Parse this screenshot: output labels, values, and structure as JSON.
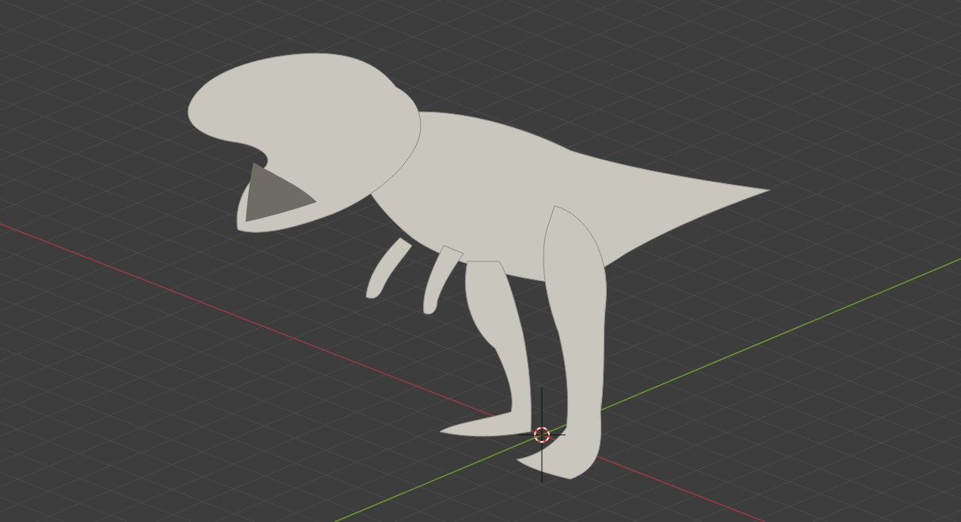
{
  "viewport": {
    "grid": true,
    "axes": [
      {
        "kind": "x",
        "color": "#9a3a3f"
      },
      {
        "kind": "y",
        "color": "#6a9a2e"
      }
    ],
    "cursor": true,
    "model": {
      "kind": "sculpt"
    }
  }
}
